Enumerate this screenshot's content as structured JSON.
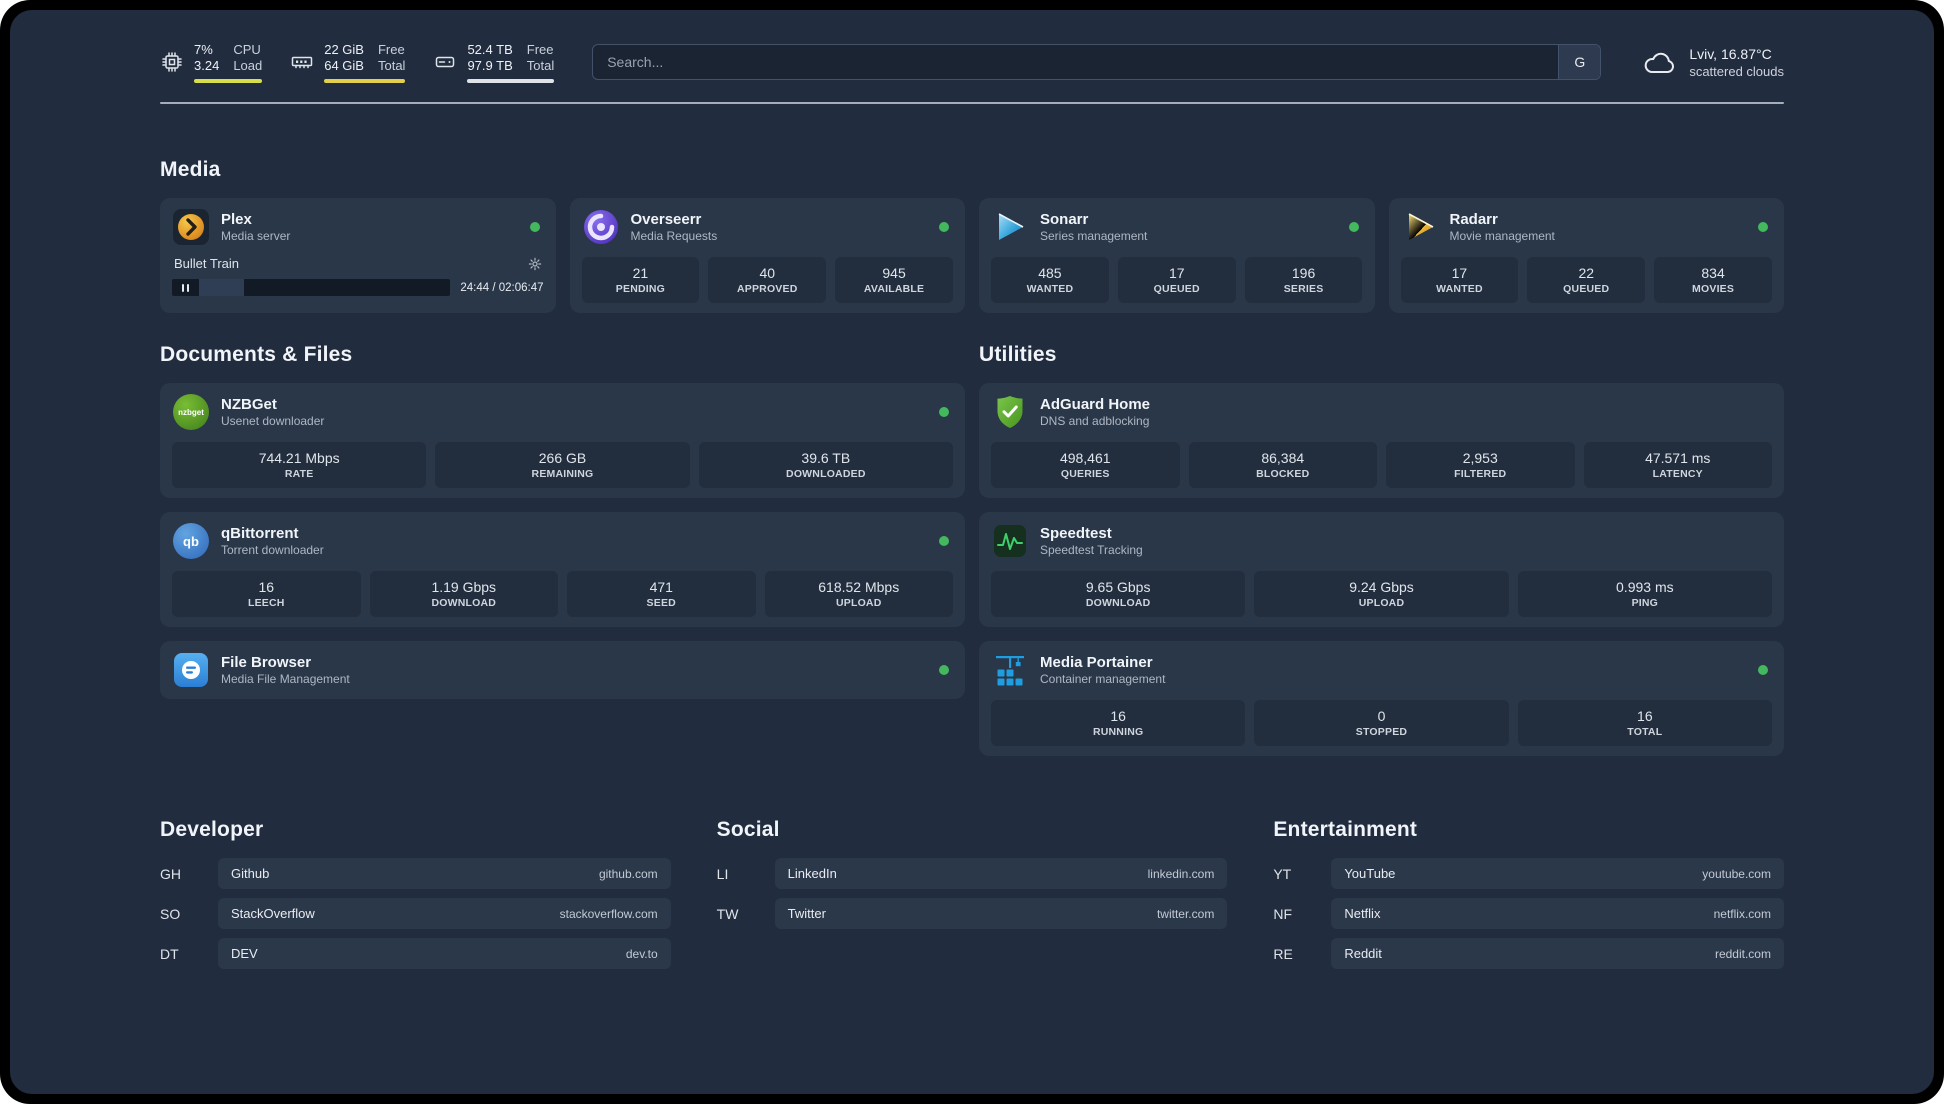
{
  "topbar": {
    "cpu": {
      "value_top": "7%",
      "value_bottom": "3.24",
      "label_top": "CPU",
      "label_bottom": "Load"
    },
    "ram": {
      "value_top": "22 GiB",
      "value_bottom": "64 GiB",
      "label_top": "Free",
      "label_bottom": "Total"
    },
    "disk": {
      "value_top": "52.4 TB",
      "value_bottom": "97.9 TB",
      "label_top": "Free",
      "label_bottom": "Total"
    },
    "search": {
      "placeholder": "Search...",
      "engine_label": "G"
    },
    "weather": {
      "location": "Lviv, 16.87°C",
      "condition": "scattered clouds"
    }
  },
  "sections": {
    "media": "Media",
    "documents": "Documents & Files",
    "utilities": "Utilities",
    "developer": "Developer",
    "social": "Social",
    "entertainment": "Entertainment"
  },
  "apps": {
    "plex": {
      "title": "Plex",
      "subtitle": "Media server",
      "now_playing": "Bullet Train",
      "time": "24:44 / 02:06:47"
    },
    "overseerr": {
      "title": "Overseerr",
      "subtitle": "Media Requests",
      "stats": [
        {
          "value": "21",
          "label": "PENDING"
        },
        {
          "value": "40",
          "label": "APPROVED"
        },
        {
          "value": "945",
          "label": "AVAILABLE"
        }
      ]
    },
    "sonarr": {
      "title": "Sonarr",
      "subtitle": "Series management",
      "stats": [
        {
          "value": "485",
          "label": "WANTED"
        },
        {
          "value": "17",
          "label": "QUEUED"
        },
        {
          "value": "196",
          "label": "SERIES"
        }
      ]
    },
    "radarr": {
      "title": "Radarr",
      "subtitle": "Movie management",
      "stats": [
        {
          "value": "17",
          "label": "WANTED"
        },
        {
          "value": "22",
          "label": "QUEUED"
        },
        {
          "value": "834",
          "label": "MOVIES"
        }
      ]
    },
    "nzbget": {
      "title": "NZBGet",
      "subtitle": "Usenet downloader",
      "icon_text": "nzbget",
      "stats": [
        {
          "value": "744.21 Mbps",
          "label": "RATE"
        },
        {
          "value": "266 GB",
          "label": "REMAINING"
        },
        {
          "value": "39.6 TB",
          "label": "DOWNLOADED"
        }
      ]
    },
    "qbittorrent": {
      "title": "qBittorrent",
      "subtitle": "Torrent downloader",
      "icon_text": "qb",
      "stats": [
        {
          "value": "16",
          "label": "LEECH"
        },
        {
          "value": "1.19 Gbps",
          "label": "DOWNLOAD"
        },
        {
          "value": "471",
          "label": "SEED"
        },
        {
          "value": "618.52 Mbps",
          "label": "UPLOAD"
        }
      ]
    },
    "filebrowser": {
      "title": "File Browser",
      "subtitle": "Media File Management"
    },
    "adguard": {
      "title": "AdGuard Home",
      "subtitle": "DNS and adblocking",
      "stats": [
        {
          "value": "498,461",
          "label": "QUERIES"
        },
        {
          "value": "86,384",
          "label": "BLOCKED"
        },
        {
          "value": "2,953",
          "label": "FILTERED"
        },
        {
          "value": "47.571 ms",
          "label": "LATENCY"
        }
      ]
    },
    "speedtest": {
      "title": "Speedtest",
      "subtitle": "Speedtest Tracking",
      "stats": [
        {
          "value": "9.65 Gbps",
          "label": "DOWNLOAD"
        },
        {
          "value": "9.24 Gbps",
          "label": "UPLOAD"
        },
        {
          "value": "0.993 ms",
          "label": "PING"
        }
      ]
    },
    "portainer": {
      "title": "Media Portainer",
      "subtitle": "Container management",
      "stats": [
        {
          "value": "16",
          "label": "RUNNING"
        },
        {
          "value": "0",
          "label": "STOPPED"
        },
        {
          "value": "16",
          "label": "TOTAL"
        }
      ]
    }
  },
  "bookmarks": {
    "developer": [
      {
        "abbr": "GH",
        "name": "Github",
        "url": "github.com"
      },
      {
        "abbr": "SO",
        "name": "StackOverflow",
        "url": "stackoverflow.com"
      },
      {
        "abbr": "DT",
        "name": "DEV",
        "url": "dev.to"
      }
    ],
    "social": [
      {
        "abbr": "LI",
        "name": "LinkedIn",
        "url": "linkedin.com"
      },
      {
        "abbr": "TW",
        "name": "Twitter",
        "url": "twitter.com"
      }
    ],
    "entertainment": [
      {
        "abbr": "YT",
        "name": "YouTube",
        "url": "youtube.com"
      },
      {
        "abbr": "NF",
        "name": "Netflix",
        "url": "netflix.com"
      },
      {
        "abbr": "RE",
        "name": "Reddit",
        "url": "reddit.com"
      }
    ]
  },
  "colors": {
    "status_online": "#43b85c",
    "cpu_bar": "#d7de4a",
    "ram_bar": "#e3cf4b",
    "disk_bar": "#dfe3e8",
    "plex_brand": "#e5a00d",
    "overseerr_brand": "#6d4ce0",
    "sonarr_brand": "#2193cf",
    "radarr_brand": "#e8a427",
    "nzbget_brand": "#54a620",
    "qbittorrent_brand": "#2f67ba",
    "filebrowser_brand": "#2b7fd4",
    "adguard_brand": "#5aa82b",
    "speedtest_brand": "#3fd06e",
    "portainer_brand": "#1e9de0"
  }
}
